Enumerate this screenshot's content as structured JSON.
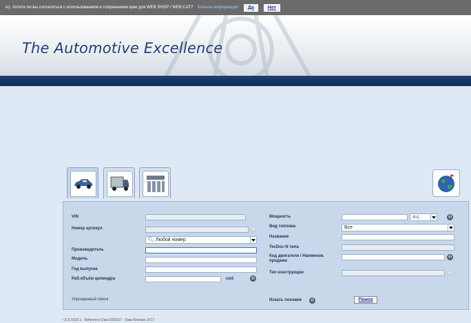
{
  "cookie": {
    "text": "ю). Хотите ли вы согласиться с использованием и сохранением куки для WEB SHOP / WEB CAT?",
    "more": "Больше информации",
    "yes": "Да",
    "no": "Нет"
  },
  "header": {
    "title": "The Automotive Excellence"
  },
  "form": {
    "vin_label": "VIN",
    "article_label": "Номер артикул",
    "article_type_value": "Любой номер",
    "manufacturer_label": "Производитель",
    "model_label": "Модель",
    "year_label": "Год выпуска",
    "displacement_label": "Раб.объём цилиндра",
    "displacement_unit": "см3",
    "power_label": "Мощность",
    "power_unit": "л.с.",
    "fuel_label": "Вид топлива",
    "fuel_value": "Все",
    "name_label": "Название",
    "tecdoc_label": "TecDoc-N типа",
    "engine_code_label": "Код двигателя / Наименов. продажи",
    "construction_label": "Тип конструкции",
    "simple_search": "Упрощенный поиск",
    "search_similar": "Искать похожее",
    "search_button": "Поиск"
  },
  "footer": {
    "text": "v2.9.1618.1 - Reference Data 03/2017 - Data Release 2017"
  },
  "icons": [
    "car-icon",
    "truck-icon",
    "parts-icon",
    "globe-icon"
  ]
}
